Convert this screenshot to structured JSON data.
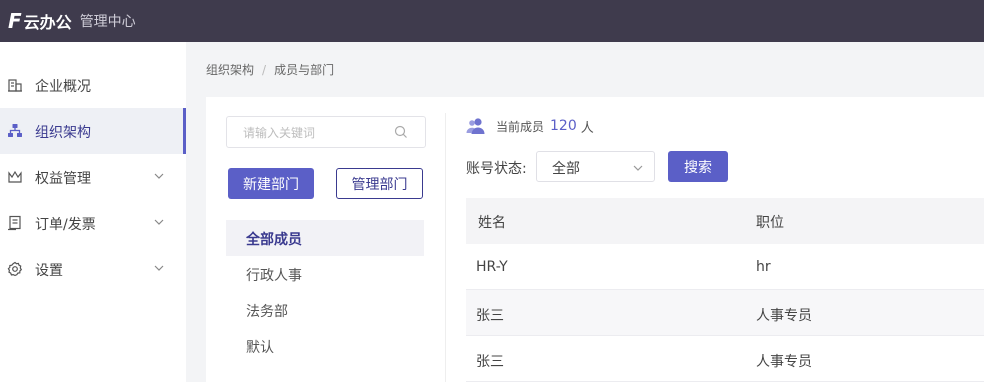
{
  "header": {
    "logo_mark": "F",
    "logo_text": "云办公",
    "subtitle": "管理中心"
  },
  "sidebar": {
    "items": [
      {
        "label": "企业概况",
        "icon": "building-icon",
        "active": false,
        "has_chevron": false
      },
      {
        "label": "组织架构",
        "icon": "org-chart-icon",
        "active": true,
        "has_chevron": false
      },
      {
        "label": "权益管理",
        "icon": "crown-icon",
        "active": false,
        "has_chevron": true
      },
      {
        "label": "订单/发票",
        "icon": "receipt-icon",
        "active": false,
        "has_chevron": true
      },
      {
        "label": "设置",
        "icon": "gear-icon",
        "active": false,
        "has_chevron": true
      }
    ]
  },
  "breadcrumb": {
    "items": [
      "组织架构",
      "成员与部门"
    ],
    "separator": "/"
  },
  "departments": {
    "search_placeholder": "请输入关键词",
    "new_button": "新建部门",
    "manage_button": "管理部门",
    "items": [
      {
        "label": "全部成员",
        "active": true
      },
      {
        "label": "行政人事",
        "active": false
      },
      {
        "label": "法务部",
        "active": false
      },
      {
        "label": "默认",
        "active": false
      }
    ]
  },
  "members": {
    "count_label": "当前成员",
    "count": "120",
    "count_unit": "人",
    "status_label": "账号状态:",
    "status_value": "全部",
    "search_button": "搜索",
    "columns": [
      "姓名",
      "职位"
    ],
    "rows": [
      [
        "HR-Y",
        "hr"
      ],
      [
        "张三",
        "人事专员"
      ],
      [
        "张三",
        "人事专员"
      ]
    ]
  },
  "colors": {
    "topbar": "#3f3b4d",
    "accent": "#5b5fc7",
    "accent_dark": "#3a3a8f"
  }
}
